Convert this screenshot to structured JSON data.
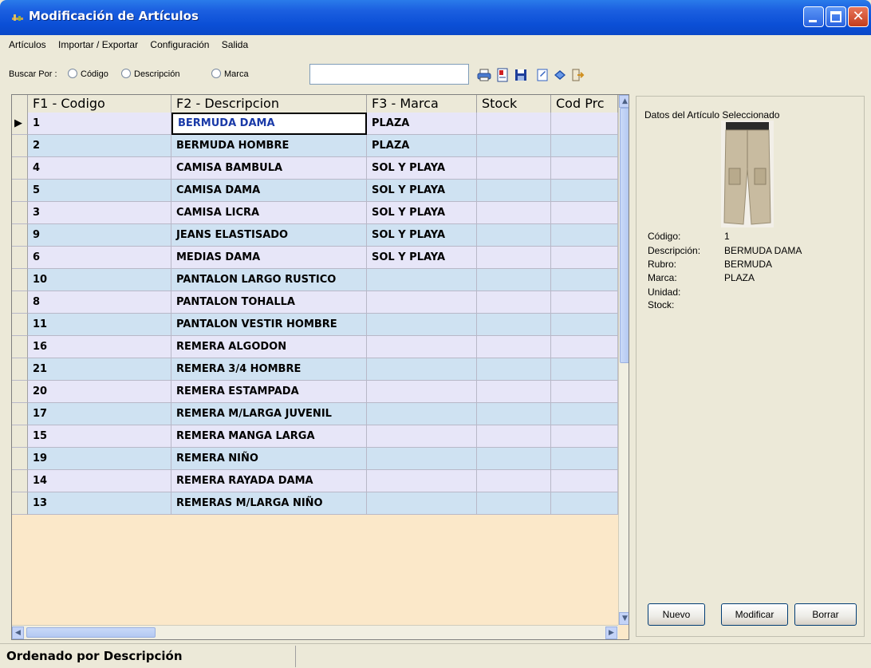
{
  "window": {
    "title": "Modificación de Artículos"
  },
  "menu": {
    "items": [
      "Artículos",
      "Importar / Exportar",
      "Configuración",
      "Salida"
    ]
  },
  "search": {
    "label": "Buscar Por :",
    "options": [
      "Código",
      "Descripción",
      "Marca"
    ],
    "value": ""
  },
  "toolbar": {
    "icons": [
      "printer-icon",
      "report-icon",
      "save-icon",
      "edit-icon",
      "books-icon",
      "exit-icon"
    ]
  },
  "grid": {
    "columns": [
      "F1 - Codigo",
      "F2 - Descripcion",
      "F3 - Marca",
      "Stock",
      "Cod Prc"
    ],
    "rows": [
      {
        "codigo": "1",
        "descripcion": "BERMUDA DAMA",
        "marca": "PLAZA"
      },
      {
        "codigo": "2",
        "descripcion": "BERMUDA HOMBRE",
        "marca": "PLAZA"
      },
      {
        "codigo": "4",
        "descripcion": "CAMISA BAMBULA",
        "marca": "SOL Y PLAYA"
      },
      {
        "codigo": "5",
        "descripcion": "CAMISA DAMA",
        "marca": "SOL Y PLAYA"
      },
      {
        "codigo": "3",
        "descripcion": "CAMISA LICRA",
        "marca": "SOL Y PLAYA"
      },
      {
        "codigo": "9",
        "descripcion": "JEANS ELASTISADO",
        "marca": "SOL Y PLAYA"
      },
      {
        "codigo": "6",
        "descripcion": "MEDIAS DAMA",
        "marca": "SOL Y PLAYA"
      },
      {
        "codigo": "10",
        "descripcion": "PANTALON LARGO RUSTICO",
        "marca": ""
      },
      {
        "codigo": "8",
        "descripcion": "PANTALON TOHALLA",
        "marca": ""
      },
      {
        "codigo": "11",
        "descripcion": "PANTALON VESTIR HOMBRE",
        "marca": ""
      },
      {
        "codigo": "16",
        "descripcion": "REMERA  ALGODON",
        "marca": ""
      },
      {
        "codigo": "21",
        "descripcion": "REMERA 3/4 HOMBRE",
        "marca": ""
      },
      {
        "codigo": "20",
        "descripcion": "REMERA ESTAMPADA",
        "marca": ""
      },
      {
        "codigo": "17",
        "descripcion": "REMERA M/LARGA JUVENIL",
        "marca": ""
      },
      {
        "codigo": "15",
        "descripcion": "REMERA MANGA LARGA",
        "marca": ""
      },
      {
        "codigo": "19",
        "descripcion": "REMERA NIÑO",
        "marca": ""
      },
      {
        "codigo": "14",
        "descripcion": "REMERA RAYADA DAMA",
        "marca": ""
      },
      {
        "codigo": "13",
        "descripcion": "REMERAS M/LARGA NIÑO",
        "marca": ""
      }
    ]
  },
  "panel": {
    "title": "Datos del Artículo Seleccionado",
    "details": [
      {
        "label": "Código:",
        "value": "1"
      },
      {
        "label": "Descripción:",
        "value": "BERMUDA DAMA"
      },
      {
        "label": "Rubro:",
        "value": "BERMUDA"
      },
      {
        "label": "Marca:",
        "value": "PLAZA"
      },
      {
        "label": "Unidad:",
        "value": ""
      },
      {
        "label": "Stock:",
        "value": ""
      }
    ],
    "buttons": {
      "new": "Nuevo",
      "modify": "Modificar",
      "delete": "Borrar"
    }
  },
  "status": {
    "text": "Ordenado por Descripción"
  }
}
